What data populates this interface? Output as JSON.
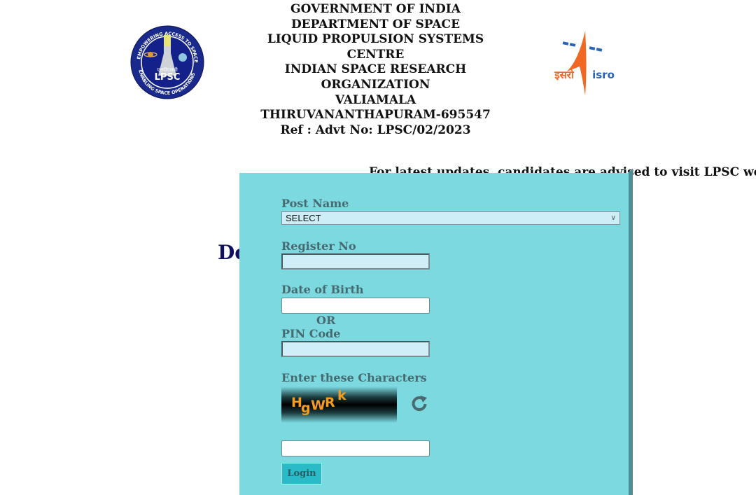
{
  "header": {
    "lines": [
      "GOVERNMENT OF INDIA",
      "DEPARTMENT OF SPACE",
      "LIQUID PROPULSION SYSTEMS",
      "CENTRE",
      "INDIAN SPACE RESEARCH",
      "ORGANIZATION",
      "VALIAMALA",
      "THIRUVANANTHAPURAM-695547",
      "Ref : Advt No: LPSC/02/2023"
    ],
    "left_logo": "lpsc-logo",
    "right_logo": "isro-logo"
  },
  "marquee": {
    "text": "For latest updates, candidates are advised to visit LPSC websi"
  },
  "background_heading": "Do",
  "form": {
    "post_name_label": "Post Name",
    "post_name_value": "SELECT",
    "register_no_label": "Register No",
    "register_no_value": "",
    "dob_label": "Date of Birth",
    "dob_value": "",
    "or_label": "OR",
    "pin_label": "PIN Code",
    "pin_value": "",
    "captcha_label": "Enter these Characters",
    "captcha_chars": [
      "H",
      "g",
      "W",
      "R",
      "k"
    ],
    "captcha_input_value": "",
    "login_label": "Login"
  },
  "colors": {
    "panel_bg": "#7cd9e0",
    "label_color": "#456a70",
    "button_bg": "#29bcc8",
    "captcha_text": "#f39c1e",
    "heading_color": "#120f5e"
  }
}
